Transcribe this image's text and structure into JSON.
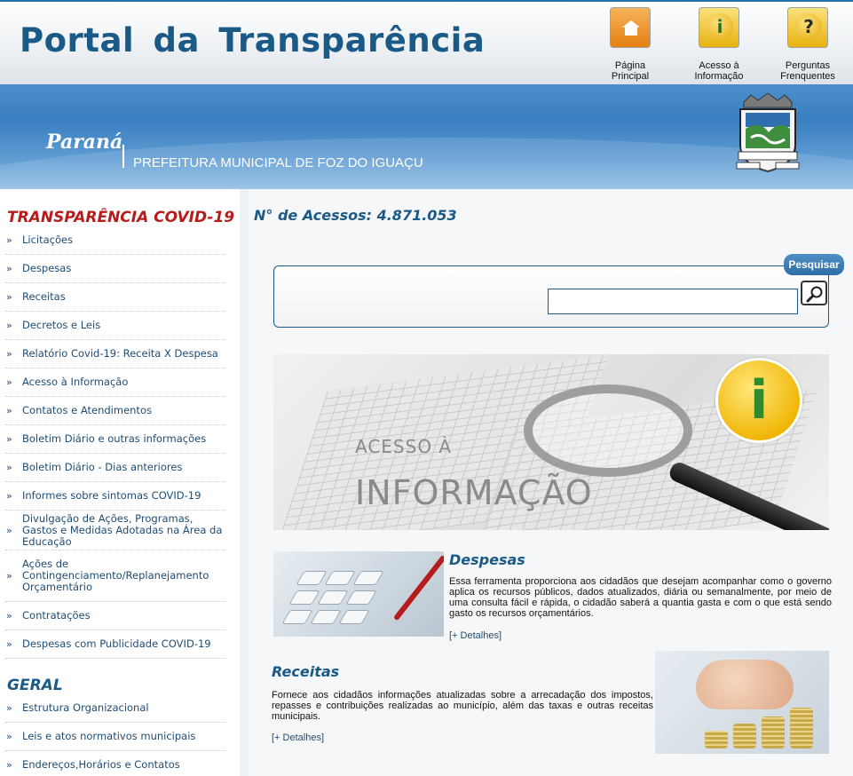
{
  "header": {
    "title": "Portal da Transparência",
    "nav": [
      {
        "label_line1": "Página",
        "label_line2": "Principal",
        "icon": "home-folder-icon"
      },
      {
        "label_line1": "Acesso à",
        "label_line2": "Informação",
        "icon": "info-icon"
      },
      {
        "label_line1": "Perguntas",
        "label_line2": "Frenquentes",
        "icon": "question-icon"
      }
    ],
    "state": "Paraná",
    "prefeitura": "PREFEITURA MUNICIPAL DE FOZ DO IGUAÇU"
  },
  "sidebar": {
    "covid_title": "TRANSPARÊNCIA COVID-19",
    "covid_items": [
      "Licitações",
      "Despesas",
      "Receitas",
      "Decretos e Leis",
      "Relatório Covid-19: Receita X Despesa",
      "Acesso à Informação",
      "Contatos e Atendimentos",
      "Boletim Diário e outras informações",
      "Boletim Diário - Dias anteriores",
      "Informes sobre sintomas COVID-19",
      "Divulgação de Ações, Programas, Gastos e Medidas Adotadas na Área da Educação",
      "Ações de Contingenciamento/Replanejamento Orçamentário",
      "Contratações",
      "Despesas com Publicidade COVID-19"
    ],
    "geral_title": "GERAL",
    "geral_items": [
      "Estrutura Organizacional",
      "Leis e atos normativos municipais",
      "Endereços,Horários e Contatos"
    ]
  },
  "main": {
    "acessos": "N° de Acessos: 4.871.053",
    "search": {
      "tab_label": "Pesquisar",
      "value": "",
      "placeholder": ""
    },
    "banner": {
      "line1": "ACESSO À",
      "line2": "INFORMAÇÃO",
      "bubble": "i"
    },
    "despesas": {
      "title": "Despesas",
      "text": "Essa ferramenta proporciona aos cidadãos que desejam acompanhar como o governo aplica os recursos públicos, dados atualizados, diária ou semanalmente, por meio de uma consulta fácil e rápida, o cidadão saberá a quantia gasta e com o que está sendo gasto os recursos orçamentários.",
      "link": "[+ Detalhes]"
    },
    "receitas": {
      "title": "Receitas",
      "text": "Fornece aos cidadãos informações atualizadas sobre a arrecadação dos impostos, repasses e contribuições realizadas ao município, além das taxas e outras receitas municipais.",
      "link": "[+ Detalhes]"
    }
  },
  "colors": {
    "brand_blue": "#1b5a86",
    "covid_red": "#b71c1c",
    "band_blue": "#3a7fc0"
  }
}
